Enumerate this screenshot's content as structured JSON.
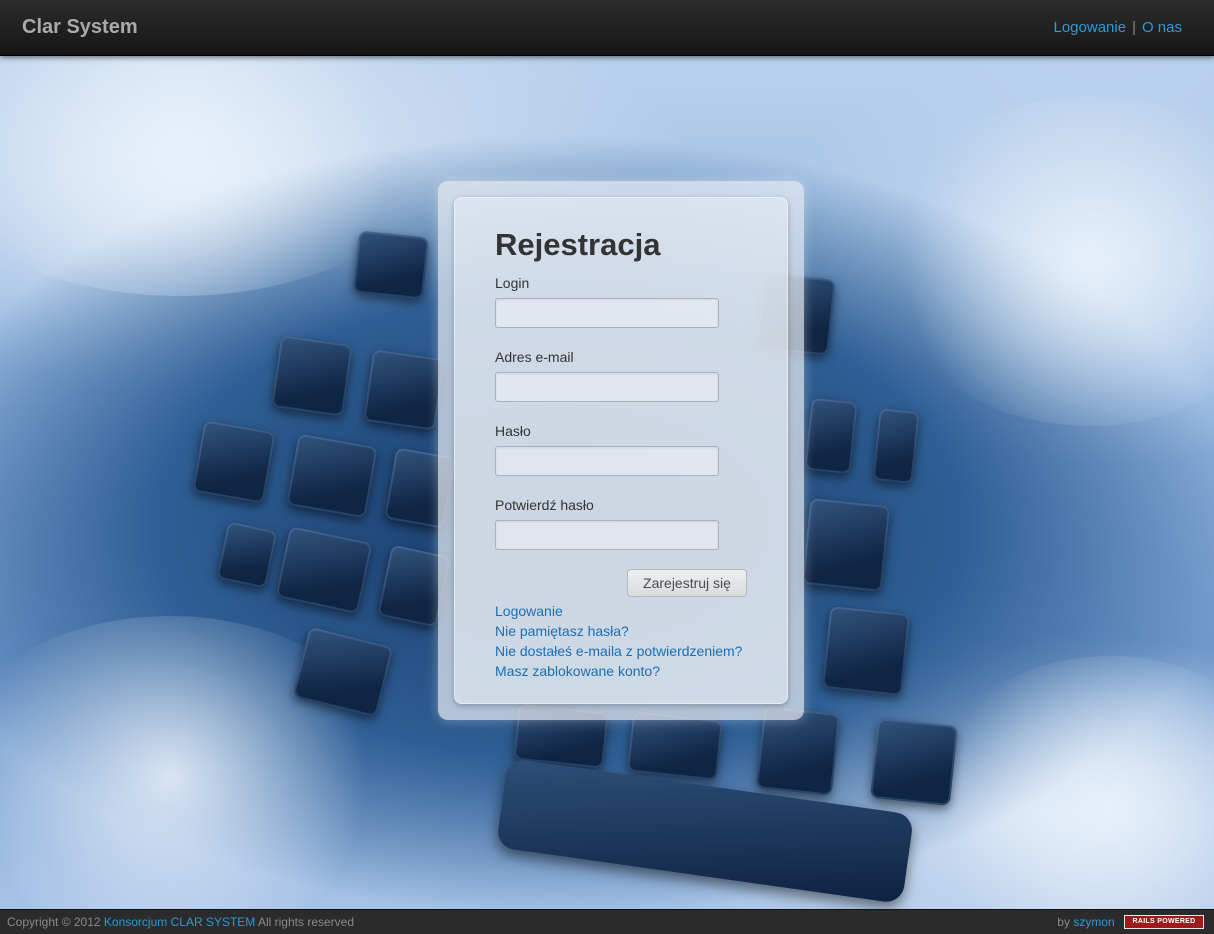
{
  "navbar": {
    "brand": "Clar System",
    "links": [
      {
        "label": "Logowanie"
      },
      {
        "label": "O nas"
      }
    ],
    "separator": "|"
  },
  "form": {
    "title": "Rejestracja",
    "fields": [
      {
        "label": "Login",
        "value": ""
      },
      {
        "label": "Adres e-mail",
        "value": ""
      },
      {
        "label": "Hasło",
        "value": ""
      },
      {
        "label": "Potwierdź hasło",
        "value": ""
      }
    ],
    "submit_label": "Zarejestruj się",
    "links": [
      "Logowanie",
      "Nie pamiętasz hasła?",
      "Nie dostałeś e-maila z potwierdzeniem?",
      "Masz zablokowane konto?"
    ]
  },
  "footer": {
    "copyright_prefix": "Copyright © 2012",
    "company_link": "Konsorcjum CLAR SYSTEM",
    "copyright_suffix": "All rights reserved",
    "by_prefix": "by",
    "author_link": "szymon",
    "badge_text": "RAILS POWERED"
  },
  "colors": {
    "link": "#1a6fb3",
    "nav_link": "#2e9ad6",
    "navbar_bg": "#1c1c1c",
    "badge_red": "#9e1b1b"
  }
}
